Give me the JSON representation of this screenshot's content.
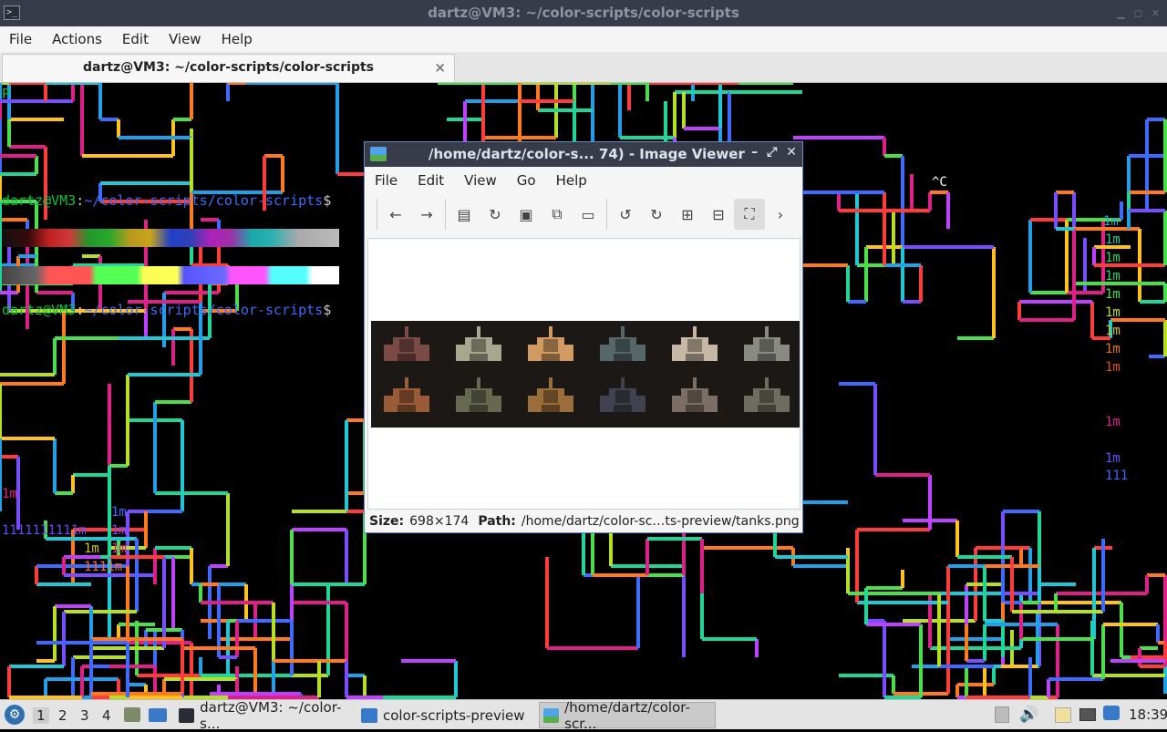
{
  "terminal": {
    "title": "dartz@VM3: ~/color-scripts/color-scripts",
    "menu": [
      "File",
      "Actions",
      "Edit",
      "View",
      "Help"
    ],
    "tab_label": "dartz@VM3: ~/color-scripts/color-scripts",
    "tab_close": "×",
    "first_line": "P",
    "prompt_user": "dartz@VM3",
    "prompt_sep": ":",
    "prompt_path": "~/color-scripts/color-scripts",
    "prompt_dollar": "$",
    "ctrl_c": "^C",
    "pipe_fragments": {
      "a": "1m",
      "b": "1111111111m",
      "c": "1111m",
      "d": "111"
    }
  },
  "image_viewer": {
    "title": "/home/dartz/color-s... 74) - Image Viewer",
    "controls": {
      "minimize": "–",
      "maximize": "⤢",
      "close": "✕"
    },
    "menu": [
      "File",
      "Edit",
      "View",
      "Go",
      "Help"
    ],
    "toolbar": [
      "back-icon",
      "forward-icon",
      "open-icon",
      "reload-icon",
      "save-icon",
      "copy-icon",
      "paste-icon",
      "rotate-left-icon",
      "rotate-right-icon",
      "zoom-in-icon",
      "zoom-out-icon",
      "fit-icon",
      "more-icon"
    ],
    "status": {
      "size_label": "Size:",
      "size_value": "698×174",
      "path_label": "Path:",
      "path_value": "/home/dartz/color-sc…ts-preview/tanks.png"
    },
    "tank_colors": [
      "#7a4a44",
      "#a5a88c",
      "#d19a62",
      "#56676a",
      "#c7b8a6",
      "#8a8a84",
      "#9a5c36",
      "#66694f",
      "#9a6d3a",
      "#40424f",
      "#7d6e64",
      "#6e6c5e"
    ]
  },
  "taskbar": {
    "workspaces": [
      "1",
      "2",
      "3",
      "4"
    ],
    "tasks": [
      {
        "label": "dartz@VM3: ~/color-s...",
        "active": false
      },
      {
        "label": "color-scripts-preview",
        "active": false
      },
      {
        "label": "/home/dartz/color-scr...",
        "active": true
      }
    ],
    "clock": "18:39"
  }
}
